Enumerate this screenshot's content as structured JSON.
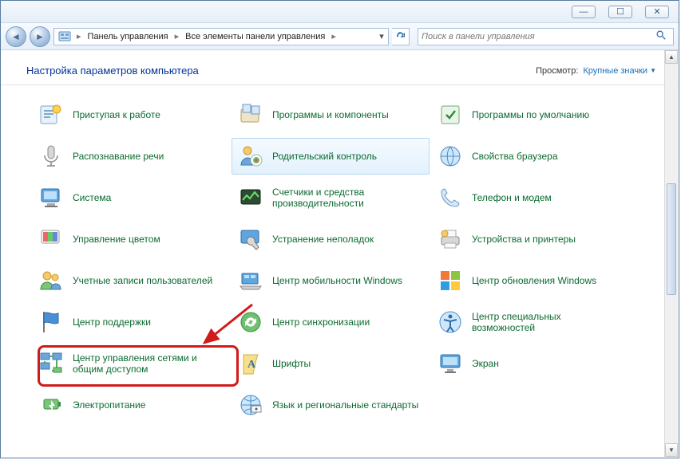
{
  "window": {
    "minimize": "—",
    "maximize": "☐",
    "close": "✕"
  },
  "nav": {
    "back": "◄",
    "forward": "►",
    "path1": "Панель управления",
    "path2": "Все элементы панели управления",
    "refresh": "↻"
  },
  "search": {
    "placeholder": "Поиск в панели управления"
  },
  "header": {
    "title": "Настройка параметров компьютера",
    "view_label": "Просмотр:",
    "view_mode": "Крупные значки"
  },
  "items": {
    "r0c0": "Приступая к работе",
    "r0c1": "Программы и компоненты",
    "r0c2": "Программы по умолчанию",
    "r1c0": "Распознавание речи",
    "r1c1": "Родительский контроль",
    "r1c2": "Свойства браузера",
    "r2c0": "Система",
    "r2c1": "Счетчики и средства производительности",
    "r2c2": "Телефон и модем",
    "r3c0": "Управление цветом",
    "r3c1": "Устранение неполадок",
    "r3c2": "Устройства и принтеры",
    "r4c0": "Учетные записи пользователей",
    "r4c1": "Центр мобильности Windows",
    "r4c2": "Центр обновления Windows",
    "r5c0": "Центр поддержки",
    "r5c1": "Центр синхронизации",
    "r5c2": "Центр специальных возможностей",
    "r6c0": "Центр управления сетями и общим доступом",
    "r6c1": "Шрифты",
    "r6c2": "Экран",
    "r7c0": "Электропитание",
    "r7c1": "Язык и региональные стандарты"
  },
  "scrollbar": {
    "up": "▲",
    "down": "▼"
  }
}
